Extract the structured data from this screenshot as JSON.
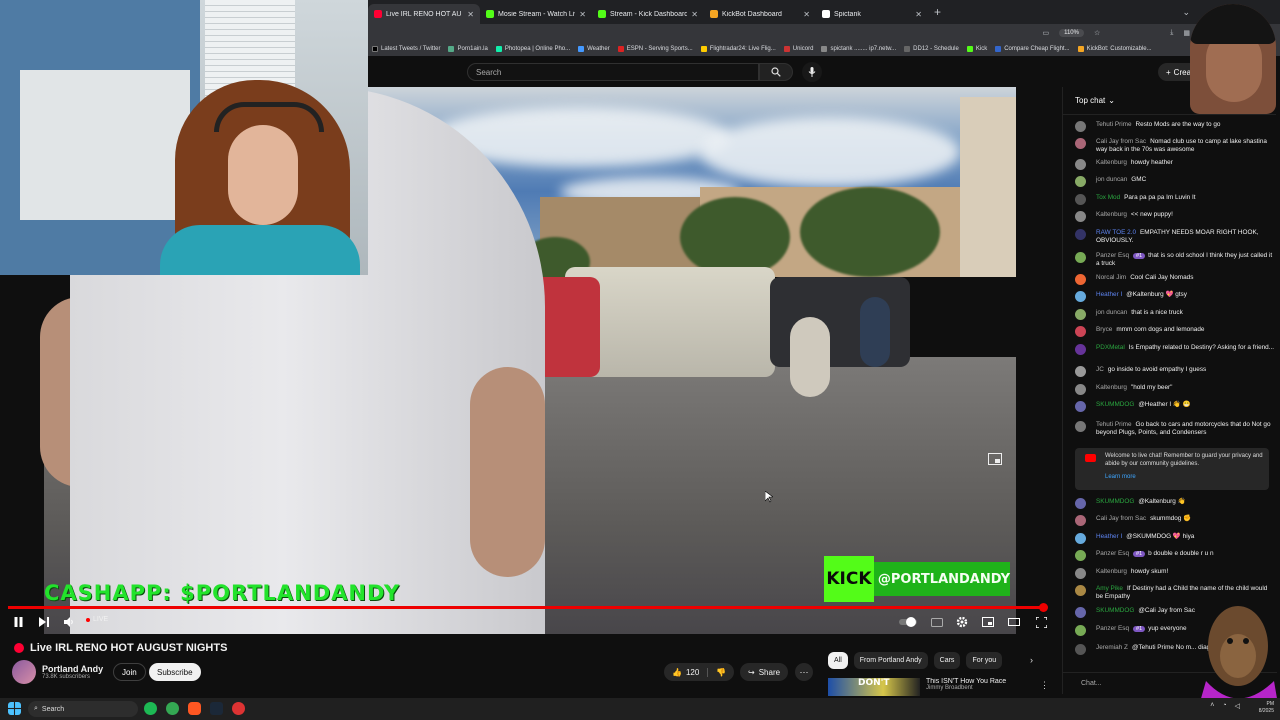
{
  "browser": {
    "tabs": [
      {
        "title": "Live IRL RENO HOT AU",
        "color": "#ff0033",
        "active": true
      },
      {
        "title": "Mosie Stream - Watch Live",
        "color": "#53fc18",
        "active": false
      },
      {
        "title": "Stream - Kick Dashboard",
        "color": "#53fc18",
        "active": false
      },
      {
        "title": "KickBot Dashboard",
        "color": "#f5a623",
        "active": false
      },
      {
        "title": "Spictank",
        "color": "#ffffff",
        "active": false
      }
    ],
    "zoom": "110%",
    "bookmarks": [
      "Latest Tweets / Twitter",
      "Porn1ain.la",
      "Photopea | Online Pho...",
      "Weather",
      "ESPN - Serving Sports...",
      "Flightradar24: Live Flig...",
      "Unicord",
      "spictank ........ ip7.netw...",
      "DD12 - Schedule",
      "Kick",
      "Compare Cheap Flight...",
      "KickBot: Customizable..."
    ]
  },
  "youtube": {
    "search_placeholder": "Search",
    "create_label": "Crea"
  },
  "overlay": {
    "cashapp": "CASHAPP: $PORTLANDANDY",
    "kick_logo": "KICK",
    "kick_handle": "@PORTLANDANDY"
  },
  "player": {
    "live_label": "LIVE"
  },
  "video": {
    "title": "Live IRL RENO HOT AUGUST NIGHTS",
    "channel": "Portland Andy",
    "subscribers": "73.8K subscribers",
    "join_label": "Join",
    "subscribe_label": "Subscribe",
    "likes": "120",
    "share_label": "Share"
  },
  "recommendations": {
    "chips": [
      "All",
      "From Portland Andy",
      "Cars",
      "For you"
    ],
    "item": {
      "thumb_text": "DON'T",
      "title": "This ISN'T How You Race",
      "channel": "Jimmy Broadbent"
    }
  },
  "chat": {
    "header": "Top chat",
    "input_placeholder": "Chat...",
    "notice": {
      "text": "Welcome to live chat! Remember to guard your privacy and abide by our community guidelines.",
      "link": "Learn more"
    },
    "messages": [
      {
        "author": "Tehuti Prime",
        "role": "",
        "badge": "",
        "text": "Resto Mods are the way to go",
        "avatar": "#777"
      },
      {
        "author": "Cali Jay from Sac",
        "role": "",
        "badge": "",
        "text": "Nomad club use to camp at lake shastina way back in the 70s was awesome",
        "avatar": "#a67"
      },
      {
        "author": "Kaltenburg",
        "role": "",
        "badge": "",
        "text": "howdy heather",
        "avatar": "#888"
      },
      {
        "author": "jon duncan",
        "role": "",
        "badge": "",
        "text": "GMC",
        "avatar": "#8a6"
      },
      {
        "author": "Tox Mod",
        "role": "mem",
        "badge": "",
        "text": "Para pa pa pa Im Luvin It",
        "avatar": "#555"
      },
      {
        "author": "Kaltenburg",
        "role": "",
        "badge": "",
        "text": "<< new puppy!",
        "avatar": "#888"
      },
      {
        "author": "RAW TOE 2.0",
        "role": "mod",
        "badge": "",
        "text": "EMPATHY NEEDS MOAR RIGHT HOOK, OBVIOUSLY.",
        "avatar": "#336"
      },
      {
        "author": "Panzer Esq",
        "role": "",
        "badge": "#1",
        "text": "that is so old school I think they just called it a truck",
        "avatar": "#7a5"
      },
      {
        "author": "Norcal Jim",
        "role": "",
        "badge": "",
        "text": "Cool Cali Jay Nomads",
        "avatar": "#e63"
      },
      {
        "author": "Heather I",
        "role": "mod",
        "badge": "",
        "text": "@Kaltenburg 💖 gtsy",
        "avatar": "#6ad"
      },
      {
        "author": "jon duncan",
        "role": "",
        "badge": "",
        "text": "that is a nice truck",
        "avatar": "#8a6"
      },
      {
        "author": "Bryce",
        "role": "",
        "badge": "",
        "text": "mmm corn dogs and lemonade",
        "avatar": "#c45"
      },
      {
        "author": "PDXMetal",
        "role": "mem",
        "badge": "",
        "text": "Is Empathy related to Destiny? Asking for a friend...",
        "avatar": "#639"
      },
      {
        "author": "JC",
        "role": "",
        "badge": "",
        "text": "go inside to avoid empathy I guess",
        "avatar": "#999"
      },
      {
        "author": "Kaltenburg",
        "role": "",
        "badge": "",
        "text": "\"hold my beer\"",
        "avatar": "#888"
      },
      {
        "author": "SKUMMDOG",
        "role": "mem",
        "badge": "",
        "text": "@Heather I 👋 😁",
        "avatar": "#66a"
      },
      {
        "author": "Tehuti Prime",
        "role": "",
        "badge": "",
        "text": "Go back to cars and motorcycles that do Not go beyond Plugs, Points, and Condensers",
        "avatar": "#777"
      },
      {
        "author": "SKUMMDOG",
        "role": "mem",
        "badge": "",
        "text": "@Kaltenburg 👋",
        "avatar": "#66a"
      },
      {
        "author": "Cali Jay from Sac",
        "role": "",
        "badge": "",
        "text": "skummdog ✊",
        "avatar": "#a67"
      },
      {
        "author": "Heather I",
        "role": "mod",
        "badge": "",
        "text": "@SKUMMDOG 💖 hiya",
        "avatar": "#6ad"
      },
      {
        "author": "Panzer Esq",
        "role": "",
        "badge": "#1",
        "text": "b double e double r u n",
        "avatar": "#7a5"
      },
      {
        "author": "Kaltenburg",
        "role": "",
        "badge": "",
        "text": "howdy skum!",
        "avatar": "#888"
      },
      {
        "author": "Amy Pike",
        "role": "mem",
        "badge": "",
        "text": "If Destiny had a Child the name of the child would be Empathy",
        "avatar": "#a84"
      },
      {
        "author": "SKUMMDOG",
        "role": "mem",
        "badge": "",
        "text": "@Cali Jay from Sac",
        "avatar": "#66a"
      },
      {
        "author": "Panzer Esq",
        "role": "",
        "badge": "#1",
        "text": "yup everyone",
        "avatar": "#7a5"
      },
      {
        "author": "Jeremiah Z",
        "role": "",
        "badge": "",
        "text": "@Tehuti Prime No m... diagnostics! lol",
        "avatar": "#555"
      }
    ]
  },
  "taskbar": {
    "search_label": "Search",
    "time": "PM",
    "date": "8/2025"
  }
}
